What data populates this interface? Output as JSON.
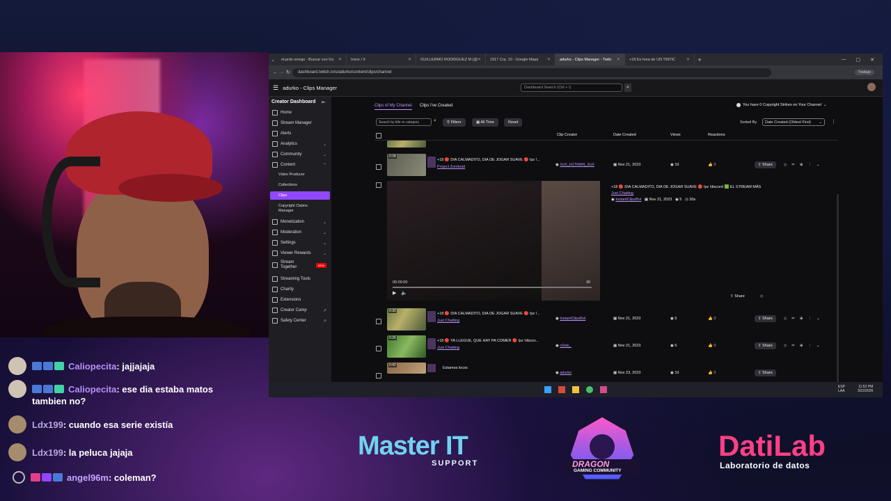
{
  "browser": {
    "tabs": [
      {
        "label": "ricardo orrego - Buscar con Go"
      },
      {
        "label": "Inicio / X"
      },
      {
        "label": "GUILLERMO RODRIGUEZ M (@"
      },
      {
        "label": "1917 Cra. 10 - Google Maps"
      },
      {
        "label": "adurko - Clips Manager - Twitc",
        "active": true
      },
      {
        "label": "+18 Es hora de UN TINTIC"
      }
    ],
    "url": "dashboard.twitch.tv/u/adurko/content/clips/channel",
    "profile_label": "Trabajo"
  },
  "dashboard": {
    "title": "adurko - Clips Manager",
    "search_placeholder": "Dashboard Search (Ctrl + /)"
  },
  "sidebar": {
    "header": "Creator Dashboard",
    "items": [
      {
        "label": "Home"
      },
      {
        "label": "Stream Manager"
      },
      {
        "label": "Alerts"
      },
      {
        "label": "Analytics"
      },
      {
        "label": "Community"
      },
      {
        "label": "Content"
      },
      {
        "label": "Video Producer"
      },
      {
        "label": "Collections"
      },
      {
        "label": "Clips"
      },
      {
        "label": "Copyright Claims Manager"
      },
      {
        "label": "Monetization"
      },
      {
        "label": "Moderation"
      },
      {
        "label": "Settings"
      },
      {
        "label": "Viewer Rewards"
      },
      {
        "label": "Stream Together"
      },
      {
        "label": "Streaming Tools"
      },
      {
        "label": "Charity"
      },
      {
        "label": "Extensions"
      },
      {
        "label": "Creator Camp"
      },
      {
        "label": "Safety Center"
      }
    ],
    "new_badge": "NEW"
  },
  "clips": {
    "tabs": [
      "Clips of My Channel",
      "Clips I've Created"
    ],
    "copyright_notice": "You have 0 Copyright Strikes on Your Channel",
    "search_placeholder": "Search by title or category",
    "filters_label": "Filters",
    "all_time_label": "All Time",
    "reset_label": "Reset",
    "sorted_by_label": "Sorted By",
    "sort_value": "Date Created (Oldest First)",
    "columns": [
      "Clip Creator",
      "Date Created",
      "Views",
      "Reactions"
    ],
    "rows": [
      {
        "duration": "0:28",
        "title": "+18 🔴 DIA CALMADITO, DIA DE JOGAR SUAVE 🔴 !pz !...",
        "category": "Project Zomboid",
        "creator": "XoX_H1TMAN_XoX",
        "date": "Nov 21, 2023",
        "views": "10",
        "reactions": "0"
      },
      {
        "duration": "0:30",
        "title": "+18 🔴 DIA CALMADITO, DIA DE JOGAR SUAVE 🔴 !pz !...",
        "category": "Just Chatting",
        "creator": "InstantClipsBot",
        "date": "Nov 21, 2023",
        "views": "5",
        "reactions": "0"
      },
      {
        "duration": "0:26",
        "title": "+18 🔴 YA LLEGUE, QUE HAY PA COMER 🔴 !pz !discor...",
        "category": "Just Chatting",
        "creator": "c0ste_",
        "date": "Nov 21, 2023",
        "views": "5",
        "reactions": "0"
      },
      {
        "duration": "0:42",
        "title": "Estamos locos",
        "category": "",
        "creator": "adurko",
        "date": "Nov 23, 2023",
        "views": "10",
        "reactions": "0"
      }
    ],
    "share_label": "Share",
    "expanded": {
      "title": "+18 🔴 DIA CALMADITO, DIA DE JOGAR SUAVE 🔴 !pz !discord 🟩 EL STREAM MÁS",
      "category": "Just Chatting",
      "creator": "InstantClipsBot",
      "date": "Nov 21, 2023",
      "views": "5",
      "length": "30s",
      "time_current": "00:00:00",
      "time_end": "30",
      "share_label": "Share"
    }
  },
  "taskbar": {
    "lang": "ESP",
    "lang2": "LAA",
    "time": "11:52 PM",
    "date": "3/22/2026"
  },
  "chat": [
    {
      "user": "Caliopecita",
      "message": ": jajjajaja"
    },
    {
      "user": "Caliopecita",
      "message": ": ese dia estaba matos"
    },
    {
      "continuation": "tambien no?"
    },
    {
      "user": "Ldx199",
      "message": ": cuando esa serie existía"
    },
    {
      "user": "Ldx199",
      "message": ": la peluca jajaja"
    },
    {
      "user": "angel96m",
      "message": ": coleman?"
    }
  ],
  "sponsors": {
    "master_it": {
      "line1": "Master IT",
      "line2": "SUPPORT"
    },
    "dragon": {
      "line1": "DRAGON",
      "line2": "GAMING COMMUNITY"
    },
    "datilab": {
      "line1": "DatiLab",
      "line2": "Laboratorio de datos"
    }
  }
}
